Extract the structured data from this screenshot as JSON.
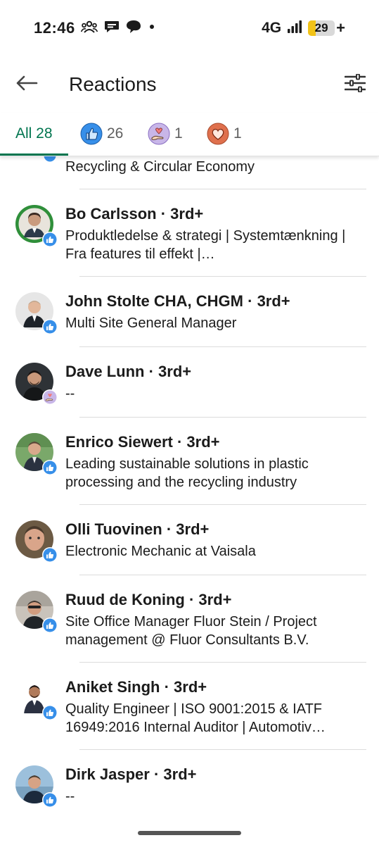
{
  "status_bar": {
    "time": "12:46",
    "network": "4G",
    "battery_level": "29",
    "battery_percent": 29,
    "battery_charging": "+",
    "icons": [
      "group-icon",
      "chat-bubble-icon",
      "threads-icon",
      "dot-icon",
      "signal-icon",
      "battery-icon"
    ]
  },
  "header": {
    "title": "Reactions",
    "back_icon": "arrow-left-icon",
    "filter_icon": "sliders-icon"
  },
  "tabs": [
    {
      "label": "All 28",
      "icon": "",
      "active": true
    },
    {
      "label": "26",
      "icon": "like-icon",
      "active": false
    },
    {
      "label": "1",
      "icon": "support-icon",
      "active": false
    },
    {
      "label": "1",
      "icon": "love-icon",
      "active": false
    }
  ],
  "colors": {
    "accent_green": "#01754f",
    "like_blue": "#378fe9",
    "love_orange": "#df704d",
    "support_purple": "#c8b6e8"
  },
  "partial_row": {
    "headline": "Recycling & Circular Economy"
  },
  "people": [
    {
      "name": "Bo Carlsson",
      "degree": "· 3rd+",
      "headline": "Produktledelse & strategi | Systemtænkning | Fra features til effekt |…",
      "reaction": "like-icon"
    },
    {
      "name": "John Stolte CHA, CHGM",
      "degree": "· 3rd+",
      "headline": "Multi Site General Manager",
      "reaction": "like-icon"
    },
    {
      "name": "Dave Lunn",
      "degree": "· 3rd+",
      "headline": "--",
      "reaction": "support-icon"
    },
    {
      "name": "Enrico Siewert",
      "degree": "· 3rd+",
      "headline": "Leading sustainable solutions in plastic processing and the recycling industry",
      "reaction": "like-icon"
    },
    {
      "name": "Olli Tuovinen",
      "degree": "· 3rd+",
      "headline": "Electronic Mechanic at Vaisala",
      "reaction": "like-icon"
    },
    {
      "name": "Ruud de Koning",
      "degree": "· 3rd+",
      "headline": "Site Office Manager Fluor Stein / Project management @ Fluor Consultants B.V.",
      "reaction": "like-icon"
    },
    {
      "name": "Aniket Singh",
      "degree": "· 3rd+",
      "headline": "Quality Engineer | ISO 9001:2015 & IATF 16949:2016 Internal Auditor | Automotiv…",
      "reaction": "like-icon"
    },
    {
      "name": "Dirk Jasper",
      "degree": "· 3rd+",
      "headline": "--",
      "reaction": "like-icon"
    }
  ]
}
